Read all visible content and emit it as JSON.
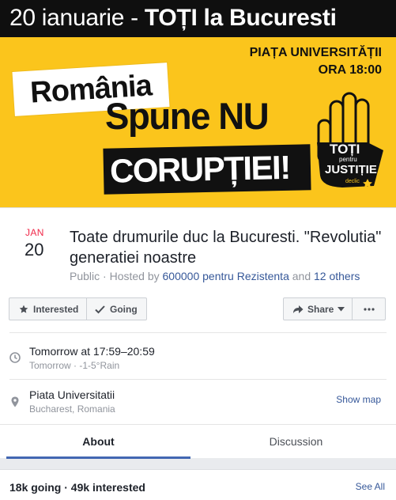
{
  "banner": {
    "top_prefix": "20 ianuarie - ",
    "top_bold": "TOȚI la Bucuresti",
    "location_line1": "PIAȚA UNIVERSITĂȚII",
    "location_line2": "ORA 18:00",
    "romania": "România",
    "spune": "Spune NU",
    "coruptiei": "CORUPȚIEI!",
    "badge_toti": "TOȚI",
    "badge_pentru": "pentru",
    "badge_justitie": "JUSTIȚIE",
    "badge_declic": "declic"
  },
  "event": {
    "month": "JAN",
    "day": "20",
    "title": "Toate drumurile duc la Bucuresti. \"Revolutia\" generatiei noastre",
    "privacy": "Public",
    "hosted_by_prefix": " · Hosted by ",
    "host": "600000 pentru Rezistenta",
    "and": " and ",
    "others": "12 others"
  },
  "actions": {
    "interested": "Interested",
    "going": "Going",
    "share": "Share"
  },
  "time": {
    "main": "Tomorrow at 17:59–20:59",
    "sub": "Tomorrow · -1-5°Rain"
  },
  "place": {
    "name": "Piata Universitatii",
    "city": "Bucharest, Romania",
    "show_map": "Show map"
  },
  "tabs": [
    {
      "label": "About",
      "active": true
    },
    {
      "label": "Discussion",
      "active": false
    }
  ],
  "stats": {
    "text": "18k going · 49k interested",
    "see_all": "See All"
  },
  "colors": {
    "banner_yellow": "#fbc51c",
    "date_red": "#f02849",
    "link_blue": "#365899",
    "tab_underline": "#4267b2"
  }
}
